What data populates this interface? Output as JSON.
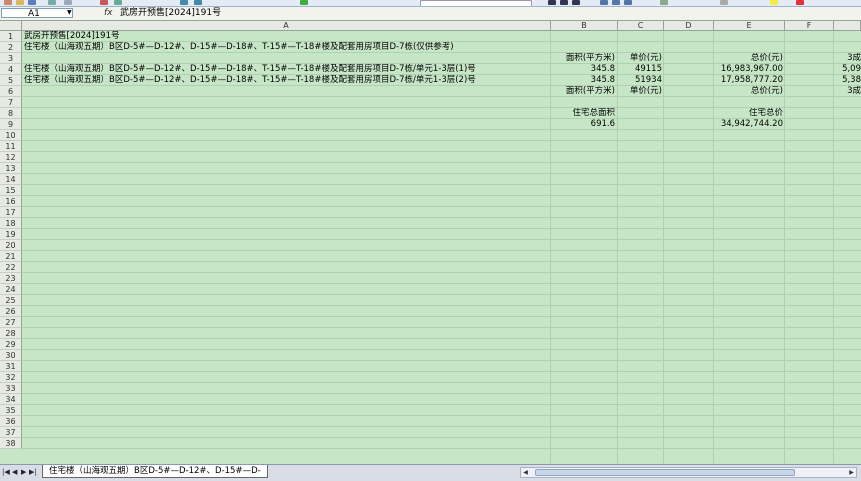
{
  "formula_bar": {
    "name_box": "A1",
    "fx_label": "fx",
    "content": "武房开预售[2024]191号"
  },
  "columns": [
    "A",
    "B",
    "C",
    "D",
    "E",
    "F"
  ],
  "row_numbers": [
    "1",
    "2",
    "3",
    "4",
    "5",
    "6",
    "7",
    "8",
    "9",
    "10",
    "11",
    "12",
    "13",
    "14",
    "15",
    "16",
    "17",
    "18",
    "19",
    "20",
    "21",
    "22",
    "23",
    "24",
    "25",
    "26",
    "27",
    "28",
    "29",
    "30",
    "31",
    "32",
    "33",
    "34",
    "35",
    "36",
    "37",
    "38"
  ],
  "cells": {
    "a1": "武房开预售[2024]191号",
    "a2": "住宅楼（山海观五期）B区D-5#—D-12#、D-15#—D-18#、T-15#—T-18#楼及配套用房项目D-7栋(仅供参考)",
    "b3": "面积(平方米)",
    "c3": "单价(元)",
    "e3": "总价(元)",
    "f3": "3成",
    "a4": "住宅楼（山海观五期）B区D-5#—D-12#、D-15#—D-18#、T-15#—T-18#楼及配套用房项目D-7栋/单元1-3层(1)号",
    "b4": "345.8",
    "c4": "49115",
    "e4": "16,983,967.00",
    "f4": "5,09",
    "a5": "住宅楼（山海观五期）B区D-5#—D-12#、D-15#—D-18#、T-15#—T-18#楼及配套用房项目D-7栋/单元1-3层(2)号",
    "b5": "345.8",
    "c5": "51934",
    "e5": "17,958,777.20",
    "f5": "5,38",
    "b6": "面积(平方米)",
    "c6": "单价(元)",
    "e6": "总价(元)",
    "f6": "3成",
    "b8": "住宅总面积",
    "e8": "住宅总价",
    "b9": "691.6",
    "e9": "34,942,744.20"
  },
  "sheet_tab": "住宅楼（山海观五期）B区D-5#—D-12#、D-15#—D-",
  "nav_buttons": [
    "|◀",
    "◀",
    "▶",
    "▶|"
  ]
}
